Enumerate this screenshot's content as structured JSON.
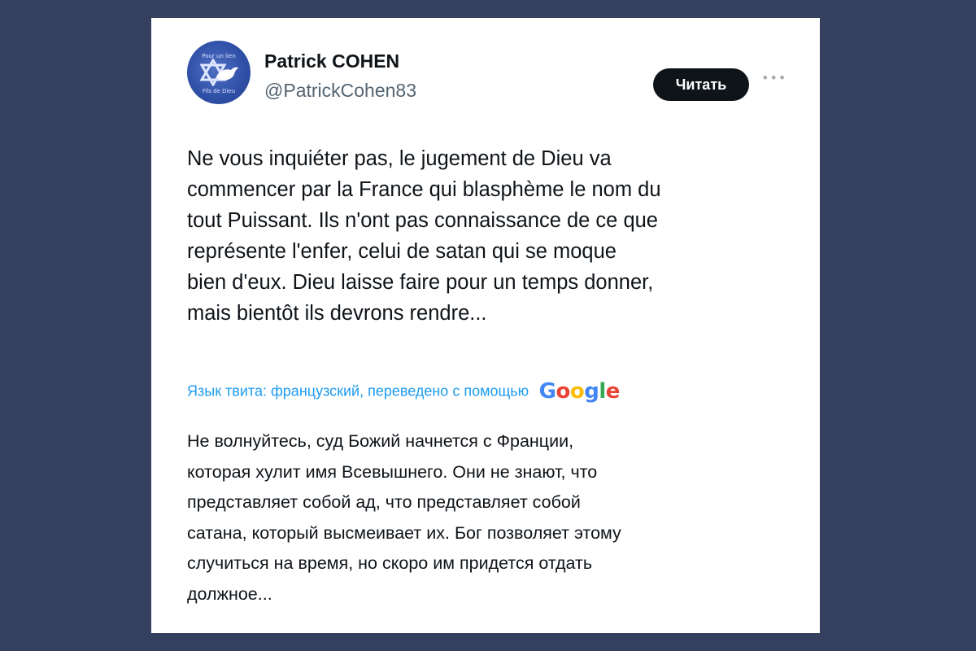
{
  "author": {
    "name": "Patrick COHEN",
    "handle": "@PatrickCohen83",
    "avatar_text_top": "Pour un lien",
    "avatar_text_bottom": "Fils de Dieu"
  },
  "follow_button": {
    "label": "Читать"
  },
  "more_icon": "more-horizontal-icon",
  "tweet": {
    "text": "Ne vous inquiéter pas, le jugement de Dieu va\ncommencer par la France qui blasphème le nom du\ntout Puissant. Ils n'ont pas connaissance de ce que\nreprésente l'enfer, celui de satan qui se moque\nbien d'eux. Dieu laisse faire pour un temps donner,\nmais bientôt ils devrons rendre..."
  },
  "translation": {
    "label": "Язык твита: французский, переведено с помощью",
    "provider": "Google",
    "text": "Не волнуйтесь, суд Божий начнется с Франции,\nкоторая хулит имя Всевышнего. Они не знают, что\nпредставляет собой ад, что представляет собой\nсатана, который высмеивает их. Бог позволяет этому\nслучиться на время, но скоро им придется отдать\nдолжное..."
  },
  "colors": {
    "background": "#353f5e",
    "card": "#ffffff",
    "accent": "#1d9bf0",
    "text": "#0f1419",
    "secondary_text": "#536471"
  }
}
